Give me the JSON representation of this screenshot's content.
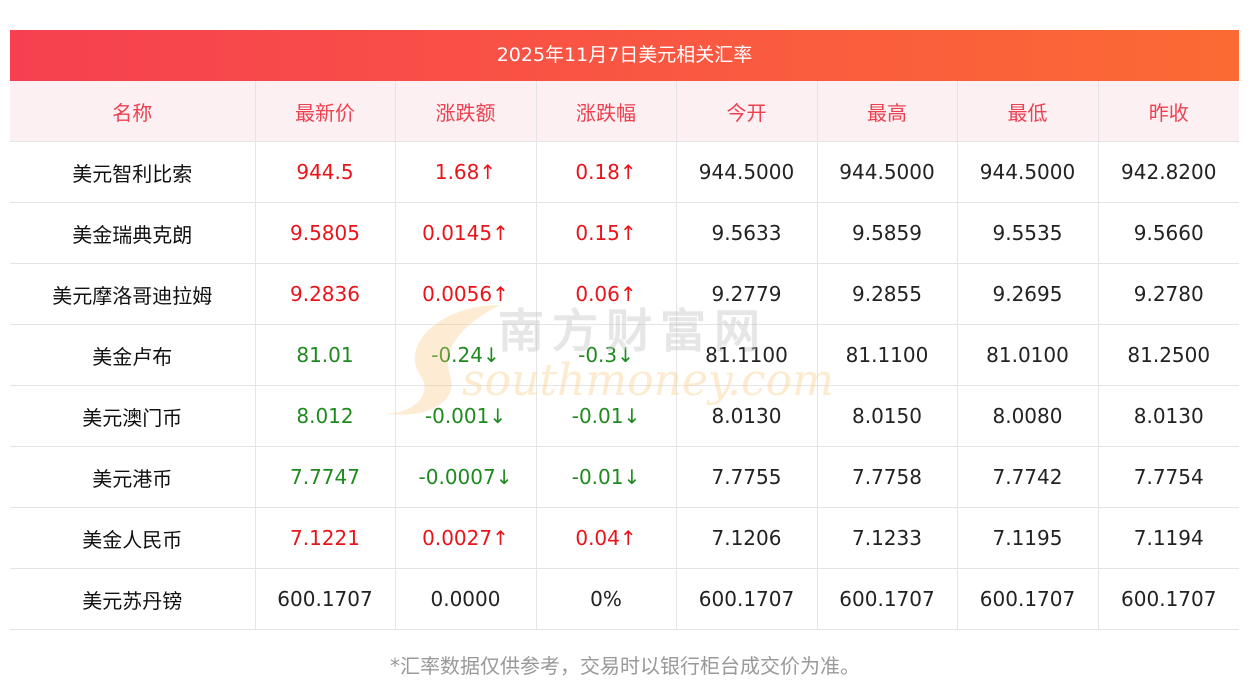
{
  "title": "2025年11月7日美元相关汇率",
  "columns": [
    "名称",
    "最新价",
    "涨跌额",
    "涨跌幅",
    "今开",
    "最高",
    "最低",
    "昨收"
  ],
  "rows": [
    {
      "name": "美元智利比索",
      "latest": "944.5",
      "change": "1.68↑",
      "pct": "0.18↑",
      "open": "944.5000",
      "high": "944.5000",
      "low": "944.5000",
      "prev": "942.8200",
      "dir": "up"
    },
    {
      "name": "美金瑞典克朗",
      "latest": "9.5805",
      "change": "0.0145↑",
      "pct": "0.15↑",
      "open": "9.5633",
      "high": "9.5859",
      "low": "9.5535",
      "prev": "9.5660",
      "dir": "up"
    },
    {
      "name": "美元摩洛哥迪拉姆",
      "latest": "9.2836",
      "change": "0.0056↑",
      "pct": "0.06↑",
      "open": "9.2779",
      "high": "9.2855",
      "low": "9.2695",
      "prev": "9.2780",
      "dir": "up"
    },
    {
      "name": "美金卢布",
      "latest": "81.01",
      "change": "-0.24↓",
      "pct": "-0.3↓",
      "open": "81.1100",
      "high": "81.1100",
      "low": "81.0100",
      "prev": "81.2500",
      "dir": "down"
    },
    {
      "name": "美元澳门币",
      "latest": "8.012",
      "change": "-0.001↓",
      "pct": "-0.01↓",
      "open": "8.0130",
      "high": "8.0150",
      "low": "8.0080",
      "prev": "8.0130",
      "dir": "down"
    },
    {
      "name": "美元港币",
      "latest": "7.7747",
      "change": "-0.0007↓",
      "pct": "-0.01↓",
      "open": "7.7755",
      "high": "7.7758",
      "low": "7.7742",
      "prev": "7.7754",
      "dir": "down"
    },
    {
      "name": "美金人民币",
      "latest": "7.1221",
      "change": "0.0027↑",
      "pct": "0.04↑",
      "open": "7.1206",
      "high": "7.1233",
      "low": "7.1195",
      "prev": "7.1194",
      "dir": "up"
    },
    {
      "name": "美元苏丹镑",
      "latest": "600.1707",
      "change": "0.0000",
      "pct": "0%",
      "open": "600.1707",
      "high": "600.1707",
      "low": "600.1707",
      "prev": "600.1707",
      "dir": "flat"
    }
  ],
  "note": "*汇率数据仅供参考，交易时以银行柜台成交价为准。",
  "watermark": {
    "cn": "南方财富网",
    "en": "southmoney.com"
  },
  "colors": {
    "up": "#e8141b",
    "down": "#1f8a1f",
    "header_text": "#ec4151",
    "header_bg": "#fdf0f2",
    "title_gradient_start": "#f64050",
    "title_gradient_end": "#fb6a33"
  }
}
